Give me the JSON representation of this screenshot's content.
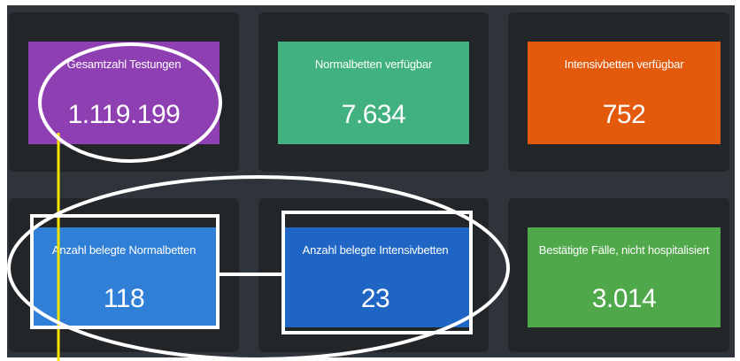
{
  "cards": [
    {
      "label": "Gesamtzahl Testungen",
      "value": "1.119.199",
      "color": "#8e3fb1"
    },
    {
      "label": "Normalbetten verfügbar",
      "value": "7.634",
      "color": "#41b27f"
    },
    {
      "label": "Intensivbetten verfügbar",
      "value": "752",
      "color": "#e35a0d"
    },
    {
      "label": "Anzahl belegte Normalbetten",
      "value": "118",
      "color": "#2f7fd6"
    },
    {
      "label": "Anzahl belegte Intensivbetten",
      "value": "23",
      "color": "#1f66c4"
    },
    {
      "label": "Bestätigte Fälle, nicht hospitalisiert",
      "value": "3.014",
      "color": "#4fa84a"
    }
  ],
  "annotations": {
    "ellipse_color": "#ffffff",
    "rect_color": "#ffffff",
    "line_color": "#f5e400"
  }
}
